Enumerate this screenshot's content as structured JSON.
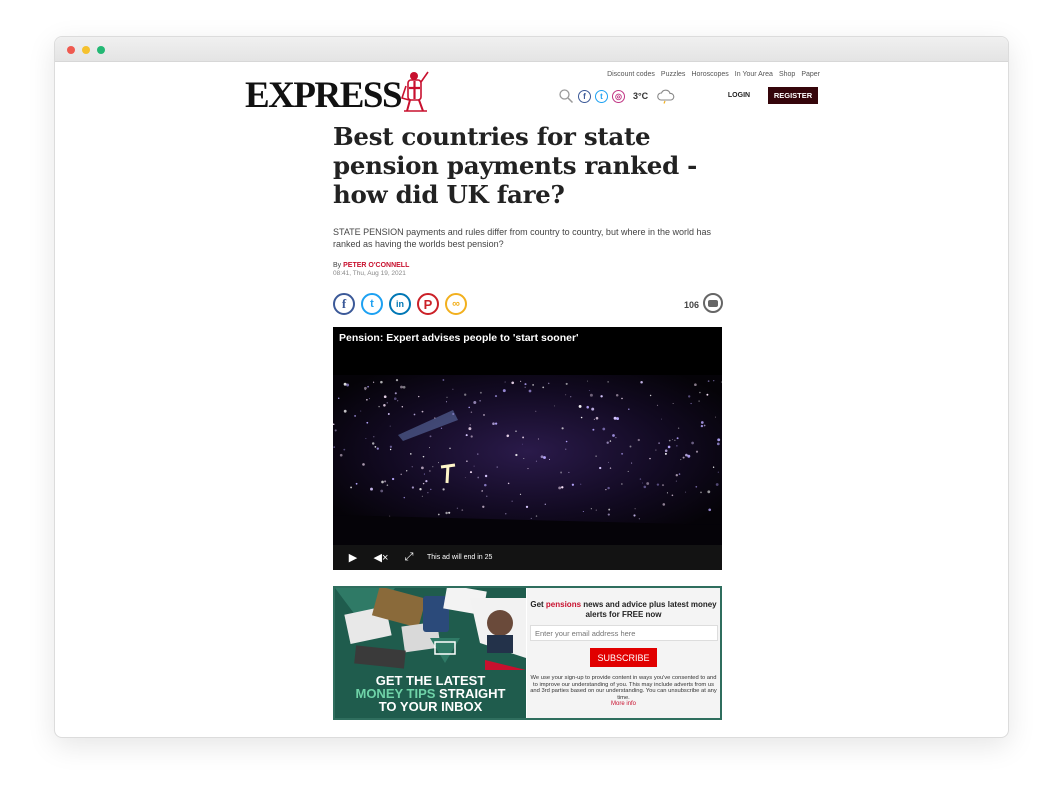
{
  "header": {
    "logo_text": "EXPRESS",
    "nav_links": [
      "Discount codes",
      "Puzzles",
      "Horoscopes",
      "In Your Area",
      "Shop",
      "Paper"
    ],
    "temperature": "3°C",
    "login_label": "LOGIN",
    "register_label": "REGISTER",
    "icons": [
      "search-icon",
      "facebook-icon",
      "twitter-icon",
      "instagram-icon",
      "weather-cloud-icon"
    ]
  },
  "article": {
    "headline": "Best countries for state pension payments ranked - how did UK fare?",
    "standfirst": "STATE PENSION payments and rules differ from country to country, but where in the world has ranked as having the worlds best pension?",
    "by_prefix": "By",
    "author": "PETER O'CONNELL",
    "date": "08:41, Thu, Aug 19, 2021",
    "comment_count": "106",
    "share_icons": [
      "facebook-icon",
      "twitter-icon",
      "linkedin-icon",
      "pinterest-icon",
      "link-icon"
    ]
  },
  "video": {
    "title": "Pension: Expert advises people to 'start sooner'",
    "ad_text": "This ad will end in 25",
    "controls": [
      "play-icon",
      "mute-icon",
      "fullscreen-icon"
    ]
  },
  "newsletter": {
    "promo_line1": "GET THE LATEST",
    "promo_line2_highlight": "MONEY TIPS",
    "promo_line2_rest": " STRAIGHT",
    "promo_line3": "TO YOUR INBOX",
    "heading_before": "Get ",
    "heading_keyword": "pensions",
    "heading_after": " news and advice plus latest money alerts for FREE now",
    "email_placeholder": "Enter your email address here",
    "subscribe_label": "SUBSCRIBE",
    "legal_text": "We use your sign-up to provide content in ways you've consented to and to improve our understanding of you. This may include adverts from us and 3rd parties based on our understanding. You can unsubscribe at any time.",
    "more_info": "More info"
  },
  "colors": {
    "brand_dark": "#35050a",
    "accent_red": "#c8102e",
    "newsletter_green": "#1f5c4d",
    "subscribe_red": "#e10000"
  }
}
